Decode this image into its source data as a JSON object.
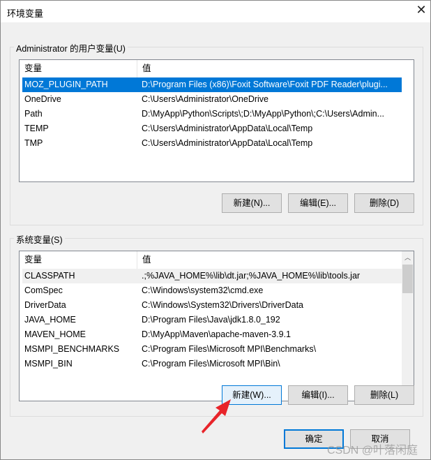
{
  "window": {
    "title": "环境变量",
    "close_icon": "close-icon"
  },
  "user_vars": {
    "group_label": "Administrator 的用户变量(U)",
    "columns": [
      "变量",
      "值"
    ],
    "rows": [
      {
        "name": "MOZ_PLUGIN_PATH",
        "value": "D:\\Program Files (x86)\\Foxit Software\\Foxit PDF Reader\\plugi...",
        "selected": true
      },
      {
        "name": "OneDrive",
        "value": "C:\\Users\\Administrator\\OneDrive"
      },
      {
        "name": "Path",
        "value": "D:\\MyApp\\Python\\Scripts\\;D:\\MyApp\\Python\\;C:\\Users\\Admin..."
      },
      {
        "name": "TEMP",
        "value": "C:\\Users\\Administrator\\AppData\\Local\\Temp"
      },
      {
        "name": "TMP",
        "value": "C:\\Users\\Administrator\\AppData\\Local\\Temp"
      }
    ],
    "buttons": {
      "new": "新建(N)...",
      "edit": "编辑(E)...",
      "delete": "删除(D)"
    }
  },
  "system_vars": {
    "group_label": "系统变量(S)",
    "columns": [
      "变量",
      "值"
    ],
    "rows": [
      {
        "name": "CLASSPATH",
        "value": ".;%JAVA_HOME%\\lib\\dt.jar;%JAVA_HOME%\\lib\\tools.jar",
        "hovered": true
      },
      {
        "name": "ComSpec",
        "value": "C:\\Windows\\system32\\cmd.exe"
      },
      {
        "name": "DriverData",
        "value": "C:\\Windows\\System32\\Drivers\\DriverData"
      },
      {
        "name": "JAVA_HOME",
        "value": "D:\\Program Files\\Java\\jdk1.8.0_192"
      },
      {
        "name": "MAVEN_HOME",
        "value": "D:\\MyApp\\Maven\\apache-maven-3.9.1"
      },
      {
        "name": "MSMPI_BENCHMARKS",
        "value": "C:\\Program Files\\Microsoft MPI\\Benchmarks\\"
      },
      {
        "name": "MSMPI_BIN",
        "value": "C:\\Program Files\\Microsoft MPI\\Bin\\"
      }
    ],
    "buttons": {
      "new": "新建(W)...",
      "edit": "编辑(I)...",
      "delete": "删除(L)"
    }
  },
  "footer": {
    "ok": "确定",
    "cancel": "取消"
  },
  "watermark": "CSDN @叶落闲庭",
  "colors": {
    "selection": "#0078d7",
    "annotation_arrow": "#e8242a"
  }
}
